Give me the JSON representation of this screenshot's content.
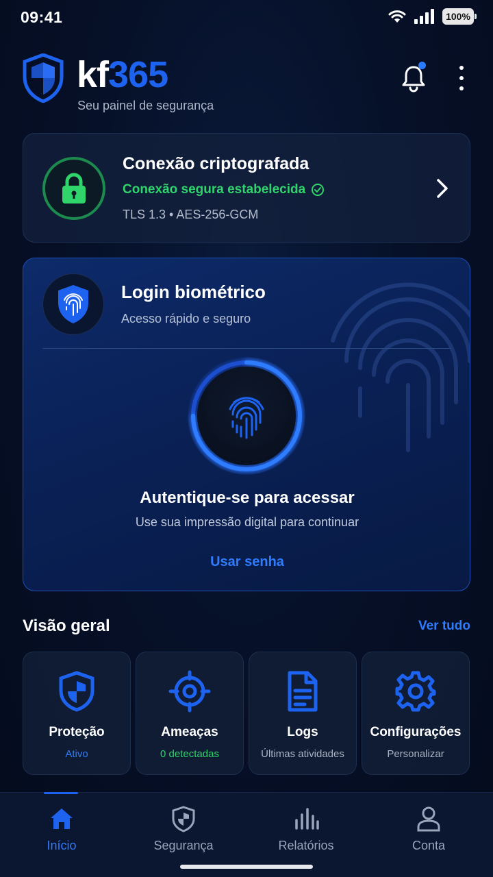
{
  "status_bar": {
    "time": "09:41",
    "battery": "100%"
  },
  "header": {
    "brand_prefix": "kf",
    "brand_number": "365",
    "tagline": "Seu painel de segurança"
  },
  "encryption_card": {
    "title": "Conexão criptografada",
    "status": "Conexão segura estabelecida",
    "detail": "TLS 1.3 • AES-256-GCM"
  },
  "biometric_card": {
    "title": "Login biométrico",
    "subtitle": "Acesso rápido e seguro",
    "auth_title": "Autentique-se para acessar",
    "auth_subtitle": "Use sua impressão digital para continuar",
    "password_link": "Usar senha"
  },
  "overview": {
    "title": "Visão geral",
    "see_all": "Ver tudo",
    "tiles": [
      {
        "icon": "shield-icon",
        "title": "Proteção",
        "subtitle": "Ativo",
        "subtitle_color": "#2f7cff"
      },
      {
        "icon": "target-icon",
        "title": "Ameaças",
        "subtitle": "0 detectadas",
        "subtitle_color": "#2fd46a"
      },
      {
        "icon": "document-icon",
        "title": "Logs",
        "subtitle": "Últimas atividades",
        "subtitle_color": "#aab3c4"
      },
      {
        "icon": "gear-icon",
        "title": "Configurações",
        "subtitle": "Personalizar",
        "subtitle_color": "#aab3c4"
      }
    ]
  },
  "bottom_nav": {
    "items": [
      {
        "icon": "home-icon",
        "label": "Início",
        "active": true
      },
      {
        "icon": "shield-icon",
        "label": "Segurança",
        "active": false
      },
      {
        "icon": "chart-icon",
        "label": "Relatórios",
        "active": false
      },
      {
        "icon": "user-icon",
        "label": "Conta",
        "active": false
      }
    ]
  },
  "colors": {
    "accent": "#1e63f0",
    "link": "#2f7cff",
    "success": "#2fd46a",
    "background": "#061028"
  }
}
